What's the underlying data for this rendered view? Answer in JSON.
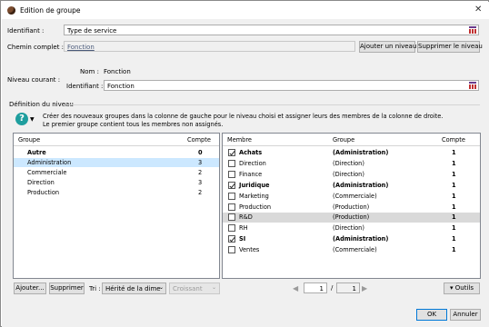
{
  "window": {
    "title": "Edition de groupe",
    "close": "✕"
  },
  "identifiant": {
    "label": "Identifiant :",
    "value": "Type de service"
  },
  "chemin": {
    "label": "Chemin complet :",
    "value": "Fonction",
    "add_level": "Ajouter un niveau",
    "remove_level": "Supprimer le niveau"
  },
  "niveau": {
    "label": "Niveau courant :",
    "nom_label": "Nom :",
    "nom_value": "Fonction",
    "id_label": "Identifiant :",
    "id_value": "Fonction"
  },
  "definition": {
    "title": "Définition du niveau",
    "help": "?",
    "info1": "Créer des nouveaux groupes dans la colonne de gauche pour le niveau choisi et assigner leurs des membres de la colonne de droite.",
    "info2": "Le premier groupe contient tous les membres non assignés."
  },
  "groups": {
    "col_group": "Groupe",
    "col_count": "Compte",
    "rows": [
      {
        "name": "Autre",
        "count": "0"
      },
      {
        "name": "Administration",
        "count": "3"
      },
      {
        "name": "Commerciale",
        "count": "2"
      },
      {
        "name": "Direction",
        "count": "3"
      },
      {
        "name": "Production",
        "count": "2"
      }
    ]
  },
  "members": {
    "col_member": "Membre",
    "col_group": "Groupe",
    "col_count": "Compte",
    "rows": [
      {
        "name": "Achats",
        "group": "(Administration)",
        "count": "1"
      },
      {
        "name": "Direction",
        "group": "(Direction)",
        "count": "1"
      },
      {
        "name": "Finance",
        "group": "(Direction)",
        "count": "1"
      },
      {
        "name": "Juridique",
        "group": "(Administration)",
        "count": "1"
      },
      {
        "name": "Marketing",
        "group": "(Commerciale)",
        "count": "1"
      },
      {
        "name": "Production",
        "group": "(Production)",
        "count": "1"
      },
      {
        "name": "R&D",
        "group": "(Production)",
        "count": "1"
      },
      {
        "name": "RH",
        "group": "(Direction)",
        "count": "1"
      },
      {
        "name": "SI",
        "group": "(Administration)",
        "count": "1"
      },
      {
        "name": "Ventes",
        "group": "(Commerciale)",
        "count": "1"
      }
    ]
  },
  "bottom": {
    "add": "Ajouter...",
    "remove": "Supprimer",
    "sort_label": "Tri :",
    "sort_value": "Hérité de la dime",
    "order_value": "Croissant",
    "page_current": "1",
    "page_sep": "/",
    "page_total": "1",
    "tools": "▾ Outils"
  },
  "footer": {
    "ok": "OK",
    "cancel": "Annuler"
  }
}
